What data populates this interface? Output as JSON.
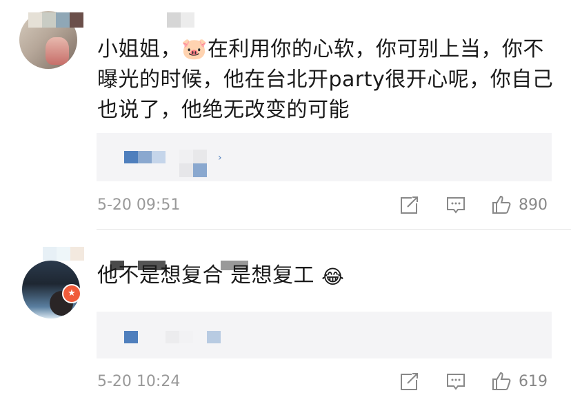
{
  "comments": [
    {
      "text": "小姐姐，🐷在利用你的心软，你可别上当，你不曝光的时候，他在台北开party很开心呢，你自己也说了，他绝无改变的可能",
      "time": "5-20 09:51",
      "likes": "890"
    },
    {
      "text": "他不是想复合 是想复工",
      "emoji": "😂",
      "time": "5-20 10:24",
      "likes": "619",
      "badge": "★"
    }
  ],
  "icons": {
    "share": "share-icon",
    "comment": "comment-icon",
    "like": "thumbs-up-icon"
  },
  "colors": {
    "text": "#1a1a1a",
    "meta": "#999999",
    "reply_bg": "#f4f4f6",
    "badge": "#f05b3a",
    "mosaic_blue": "#4f7fbd"
  }
}
